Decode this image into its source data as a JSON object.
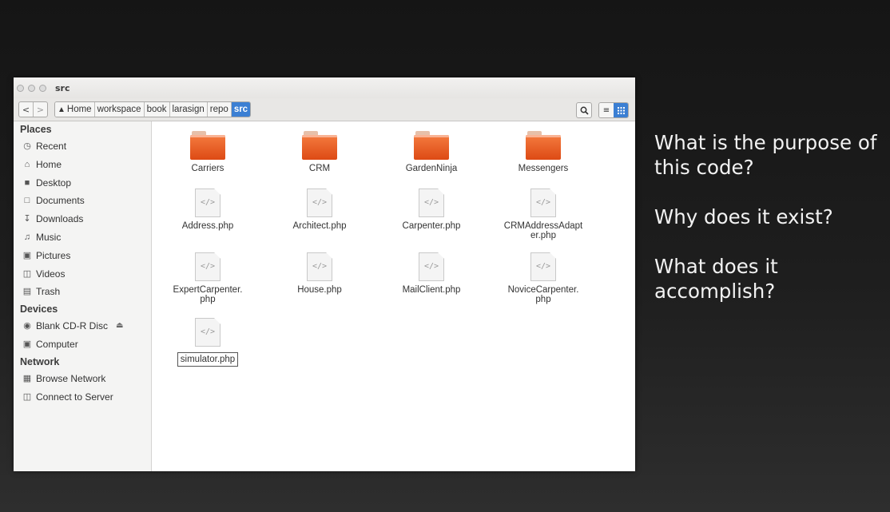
{
  "window": {
    "title": "src"
  },
  "toolbar": {
    "back_glyph": "<",
    "forward_glyph": ">",
    "breadcrumbs": [
      "Home",
      "workspace",
      "book",
      "larasign",
      "repo",
      "src"
    ]
  },
  "sidebar": {
    "places_heading": "Places",
    "places": [
      {
        "label": "Recent",
        "icon": "clock-icon"
      },
      {
        "label": "Home",
        "icon": "home-icon"
      },
      {
        "label": "Desktop",
        "icon": "desktop-icon"
      },
      {
        "label": "Documents",
        "icon": "document-icon"
      },
      {
        "label": "Downloads",
        "icon": "download-icon"
      },
      {
        "label": "Music",
        "icon": "music-icon"
      },
      {
        "label": "Pictures",
        "icon": "camera-icon"
      },
      {
        "label": "Videos",
        "icon": "film-icon"
      },
      {
        "label": "Trash",
        "icon": "trash-icon"
      }
    ],
    "devices_heading": "Devices",
    "devices": [
      {
        "label": "Blank CD-R Disc",
        "icon": "disc-icon"
      },
      {
        "label": "Computer",
        "icon": "computer-icon"
      }
    ],
    "network_heading": "Network",
    "network": [
      {
        "label": "Browse Network",
        "icon": "network-icon"
      },
      {
        "label": "Connect to Server",
        "icon": "server-icon"
      }
    ]
  },
  "files": [
    {
      "name": "Carriers",
      "type": "folder"
    },
    {
      "name": "CRM",
      "type": "folder"
    },
    {
      "name": "GardenNinja",
      "type": "folder"
    },
    {
      "name": "Messengers",
      "type": "folder"
    },
    {
      "name": "Address.php",
      "type": "php"
    },
    {
      "name": "Architect.php",
      "type": "php"
    },
    {
      "name": "Carpenter.php",
      "type": "php"
    },
    {
      "name": "CRMAddressAdapter.php",
      "type": "php",
      "display_lines": [
        "CRMAddressAdapt",
        "er.php"
      ]
    },
    {
      "name": "ExpertCarpenter.php",
      "type": "php",
      "display_lines": [
        "ExpertCarpenter.",
        "php"
      ]
    },
    {
      "name": "House.php",
      "type": "php"
    },
    {
      "name": "MailClient.php",
      "type": "php"
    },
    {
      "name": "NoviceCarpenter.php",
      "type": "php",
      "display_lines": [
        "NoviceCarpenter.",
        "php"
      ]
    },
    {
      "name": "simulator.php",
      "type": "php",
      "selected": true
    }
  ],
  "doc_glyph": "</>",
  "questions": [
    "What is the purpose of this code?",
    "Why does it exist?",
    "What does it accomplish?"
  ],
  "colors": {
    "folder": "#e8561e",
    "accent": "#3b7fd3",
    "slide_background": "#1b1b1b"
  }
}
